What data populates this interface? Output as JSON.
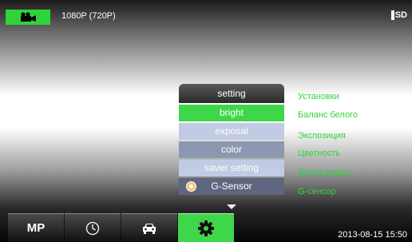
{
  "top_bar": {
    "camera_icon": "video-camera-icon",
    "resolution": "1080P (720P)",
    "sd_label": "SD",
    "sd_icon": "sd-card-icon"
  },
  "settings_menu": {
    "title": "setting",
    "items": [
      {
        "label": "bright",
        "state": "selected"
      },
      {
        "label": "exposal"
      },
      {
        "label": "color"
      },
      {
        "label": "saver setting"
      },
      {
        "label": "G-Sensor",
        "icon": "radio-dot-icon"
      }
    ]
  },
  "translations": [
    {
      "text": "Установки"
    },
    {
      "text": "Баланс белого"
    },
    {
      "text": "Экспозиция"
    },
    {
      "text": "Цветность"
    },
    {
      "text": "Длина видео"
    },
    {
      "text": "G-сенсор"
    }
  ],
  "bottom_tabs": [
    {
      "label": "MP"
    },
    {
      "icon": "clock-icon"
    },
    {
      "icon": "car-icon"
    },
    {
      "icon": "gear-icon",
      "active": true
    }
  ],
  "status": {
    "datetime": "2013-08-15  15:50"
  },
  "colors": {
    "accent_green": "#3fd64a",
    "menu_light": "#c1cbe3",
    "menu_dark": "#5e6680"
  }
}
